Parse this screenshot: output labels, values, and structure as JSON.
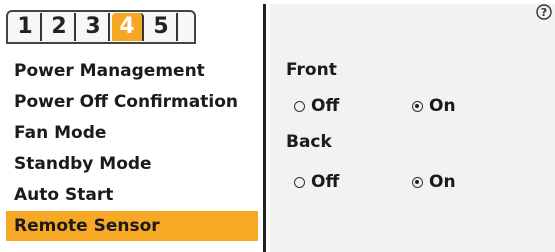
{
  "tabs": [
    {
      "label": "1",
      "active": false
    },
    {
      "label": "2",
      "active": false
    },
    {
      "label": "3",
      "active": false
    },
    {
      "label": "4",
      "active": true
    },
    {
      "label": "5",
      "active": false
    }
  ],
  "menu": {
    "items": [
      {
        "label": "Power Management"
      },
      {
        "label": "Power Off Confirmation"
      },
      {
        "label": "Fan Mode"
      },
      {
        "label": "Standby Mode"
      },
      {
        "label": "Auto Start"
      },
      {
        "label": "Remote Sensor",
        "selected": true
      }
    ]
  },
  "panel": {
    "help_icon": "help-icon",
    "front": {
      "label": "Front",
      "off_label": "Off",
      "on_label": "On",
      "selected": "On"
    },
    "back": {
      "label": "Back",
      "off_label": "Off",
      "on_label": "On",
      "selected": "On"
    }
  },
  "colors": {
    "accent": "#f7a825",
    "panel_bg": "#f2f2f2",
    "text": "#1b1b1b"
  }
}
